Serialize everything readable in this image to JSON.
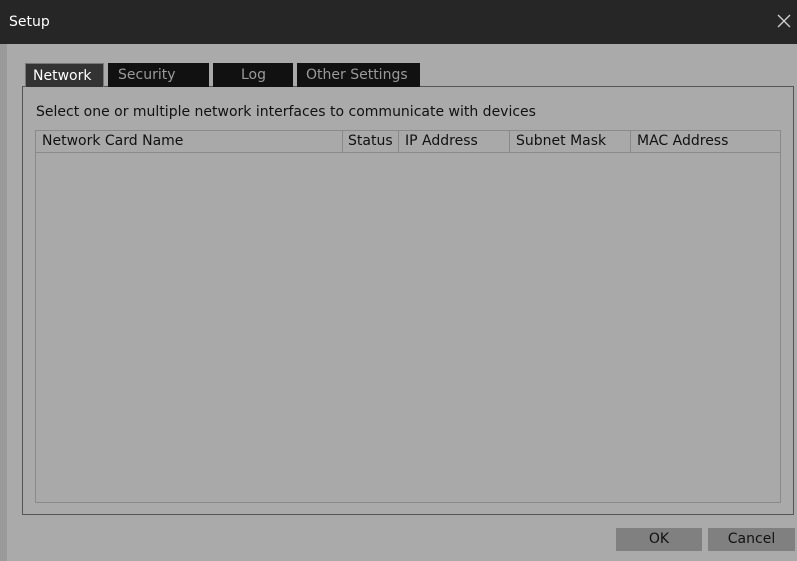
{
  "window": {
    "title": "Setup",
    "close_icon": "close-icon"
  },
  "tabs": [
    {
      "label": "Network",
      "active": true
    },
    {
      "label": "Security",
      "active": false
    },
    {
      "label": "Log",
      "active": false
    },
    {
      "label": "Other Settings",
      "active": false
    }
  ],
  "network": {
    "instruction": "Select one or multiple network interfaces to communicate with devices",
    "table": {
      "columns": [
        "Network Card Name",
        "Status",
        "IP Address",
        "Subnet Mask",
        "MAC Address"
      ],
      "rows": []
    }
  },
  "footer": {
    "ok_label": "OK",
    "cancel_label": "Cancel"
  },
  "colors": {
    "titlebar": "#262626",
    "background": "#aaaaaa",
    "tab_inactive": "#111111",
    "tab_active": "#333333",
    "button": "#808080"
  }
}
